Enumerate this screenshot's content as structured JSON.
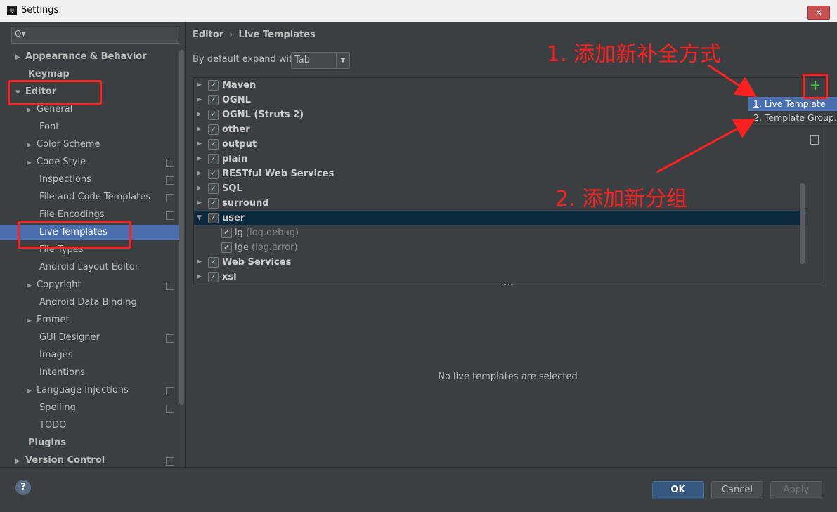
{
  "window": {
    "title": "Settings",
    "logo": "IJ"
  },
  "search": {
    "placeholder": "Q▾"
  },
  "sidebar": {
    "items": [
      {
        "label": "Appearance & Behavior"
      },
      {
        "label": "Keymap"
      },
      {
        "label": "Editor"
      },
      {
        "label": "General"
      },
      {
        "label": "Font"
      },
      {
        "label": "Color Scheme"
      },
      {
        "label": "Code Style"
      },
      {
        "label": "Inspections"
      },
      {
        "label": "File and Code Templates"
      },
      {
        "label": "File Encodings"
      },
      {
        "label": "Live Templates"
      },
      {
        "label": "File Types"
      },
      {
        "label": "Android Layout Editor"
      },
      {
        "label": "Copyright"
      },
      {
        "label": "Android Data Binding"
      },
      {
        "label": "Emmet"
      },
      {
        "label": "GUI Designer"
      },
      {
        "label": "Images"
      },
      {
        "label": "Intentions"
      },
      {
        "label": "Language Injections"
      },
      {
        "label": "Spelling"
      },
      {
        "label": "TODO"
      },
      {
        "label": "Plugins"
      },
      {
        "label": "Version Control"
      }
    ]
  },
  "main": {
    "breadcrumb": {
      "root": "Editor",
      "sep": "›",
      "current": "Live Templates"
    },
    "expand_label": "By default expand with",
    "expand_value": "Tab",
    "groups": [
      {
        "name": "Maven"
      },
      {
        "name": "OGNL"
      },
      {
        "name": "OGNL (Struts 2)"
      },
      {
        "name": "other"
      },
      {
        "name": "output"
      },
      {
        "name": "plain"
      },
      {
        "name": "RESTful Web Services"
      },
      {
        "name": "SQL"
      },
      {
        "name": "surround"
      },
      {
        "name": "user"
      },
      {
        "name": "Web Services"
      },
      {
        "name": "xsl"
      }
    ],
    "user_templates": [
      {
        "abbr": "lg",
        "desc": "(log.debug)"
      },
      {
        "abbr": "lge",
        "desc": "(log.error)"
      }
    ],
    "empty_message": "No live templates are selected"
  },
  "popup": {
    "items": [
      {
        "key": "1",
        "label": ". Live Template"
      },
      {
        "key": "2",
        "label": ". Template Group..."
      }
    ]
  },
  "annotations": {
    "step1": "1. 添加新补全方式",
    "step2": "2. 添加新分组"
  },
  "footer": {
    "help": "?",
    "ok": "OK",
    "cancel": "Cancel",
    "apply": "Apply"
  },
  "colors": {
    "accent": "#4b6eaf",
    "annotation": "#ff2020",
    "add": "#4fc14f"
  }
}
